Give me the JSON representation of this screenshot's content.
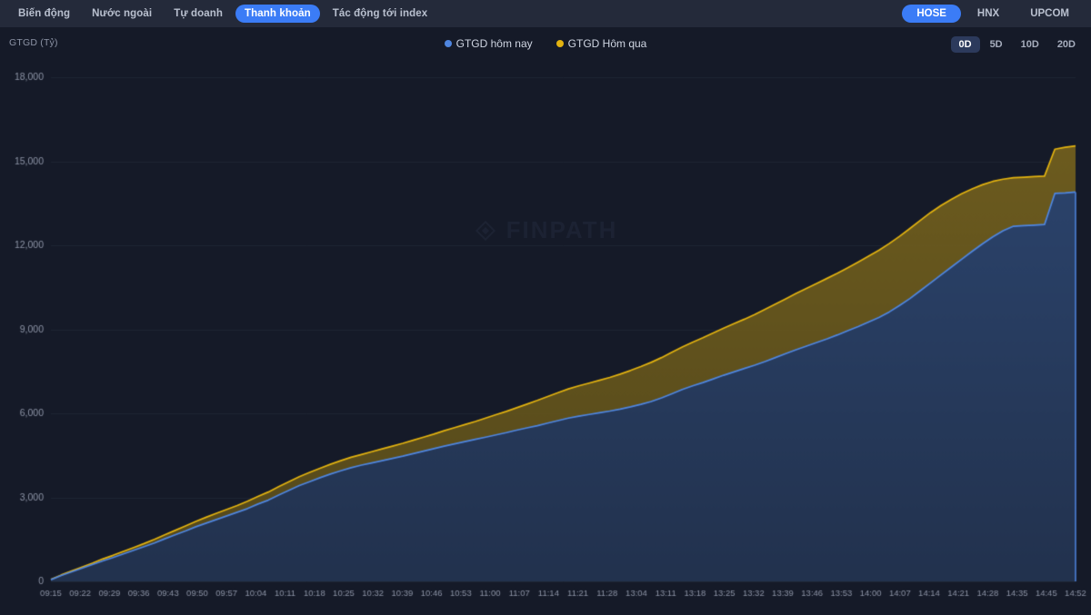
{
  "header": {
    "tabs": [
      {
        "label": "Biến động",
        "active": false
      },
      {
        "label": "Nước ngoài",
        "active": false
      },
      {
        "label": "Tự doanh",
        "active": false
      },
      {
        "label": "Thanh khoản",
        "active": true
      },
      {
        "label": "Tác động tới index",
        "active": false
      }
    ],
    "exchanges": [
      {
        "label": "HOSE",
        "active": true
      },
      {
        "label": "HNX",
        "active": false
      },
      {
        "label": "UPCOM",
        "active": false
      }
    ],
    "accent_color": "#3b7cf6"
  },
  "toolbar": {
    "ranges": [
      {
        "label": "0D",
        "active": true
      },
      {
        "label": "5D",
        "active": false
      },
      {
        "label": "10D",
        "active": false
      },
      {
        "label": "20D",
        "active": false
      }
    ]
  },
  "watermark": {
    "text": "FINPATH",
    "logo_icon": "finpath-diamond-logo"
  },
  "chart_data": {
    "type": "area",
    "title": "",
    "subtitle": "",
    "xlabel": "",
    "ylabel": "GTGD (Tỷ)",
    "ylim": [
      0,
      18000
    ],
    "yticks": [
      0,
      3000,
      6000,
      9000,
      12000,
      15000,
      18000
    ],
    "ytick_labels": [
      "0",
      "3,000",
      "6,000",
      "9,000",
      "12,000",
      "15,000",
      "18,000"
    ],
    "grid": true,
    "legend_position": "top-center",
    "x_tick_labels": [
      "09:15",
      "09:22",
      "09:29",
      "09:36",
      "09:43",
      "09:50",
      "09:57",
      "10:04",
      "10:11",
      "10:18",
      "10:25",
      "10:32",
      "10:39",
      "10:46",
      "10:53",
      "11:00",
      "11:07",
      "11:14",
      "11:21",
      "11:28",
      "13:04",
      "13:11",
      "13:18",
      "13:25",
      "13:32",
      "13:39",
      "13:46",
      "13:53",
      "14:00",
      "14:07",
      "14:14",
      "14:21",
      "14:28",
      "14:35",
      "14:45",
      "14:52"
    ],
    "series": [
      {
        "name": "GTGD hôm nay",
        "color": "#4f86e0",
        "fill": "#2b4672",
        "last_value": 13900,
        "values": [
          60,
          210,
          340,
          470,
          600,
          730,
          850,
          980,
          1110,
          1240,
          1370,
          1520,
          1660,
          1800,
          1950,
          2080,
          2210,
          2340,
          2470,
          2600,
          2760,
          2900,
          3080,
          3250,
          3420,
          3560,
          3700,
          3830,
          3950,
          4060,
          4150,
          4230,
          4310,
          4390,
          4470,
          4560,
          4650,
          4740,
          4830,
          4910,
          4990,
          5070,
          5150,
          5230,
          5310,
          5400,
          5480,
          5560,
          5650,
          5740,
          5830,
          5900,
          5960,
          6020,
          6080,
          6150,
          6230,
          6320,
          6420,
          6550,
          6700,
          6850,
          6980,
          7100,
          7230,
          7360,
          7480,
          7600,
          7720,
          7850,
          7990,
          8130,
          8270,
          8400,
          8530,
          8660,
          8800,
          8950,
          9100,
          9260,
          9420,
          9620,
          9850,
          10100,
          10380,
          10660,
          10940,
          11220,
          11500,
          11780,
          12050,
          12300,
          12520,
          12680,
          12700,
          12720,
          12740,
          13850,
          13870,
          13900
        ]
      },
      {
        "name": "GTGD Hôm qua",
        "color": "#e3b310",
        "fill": "#6b5a1c",
        "last_value": 15550,
        "values": [
          70,
          230,
          370,
          510,
          650,
          800,
          930,
          1070,
          1210,
          1350,
          1500,
          1660,
          1820,
          1980,
          2140,
          2290,
          2430,
          2570,
          2710,
          2860,
          3030,
          3190,
          3380,
          3560,
          3740,
          3890,
          4040,
          4180,
          4310,
          4430,
          4530,
          4630,
          4730,
          4830,
          4930,
          5040,
          5150,
          5260,
          5380,
          5490,
          5600,
          5710,
          5830,
          5950,
          6070,
          6200,
          6330,
          6460,
          6600,
          6740,
          6870,
          6980,
          7080,
          7180,
          7280,
          7400,
          7530,
          7670,
          7820,
          7990,
          8180,
          8370,
          8540,
          8700,
          8870,
          9040,
          9200,
          9360,
          9530,
          9710,
          9900,
          10090,
          10280,
          10460,
          10640,
          10820,
          11000,
          11200,
          11400,
          11610,
          11820,
          12060,
          12320,
          12600,
          12890,
          13170,
          13420,
          13640,
          13840,
          14010,
          14160,
          14280,
          14360,
          14410,
          14430,
          14450,
          14470,
          15430,
          15500,
          15550
        ]
      }
    ]
  }
}
